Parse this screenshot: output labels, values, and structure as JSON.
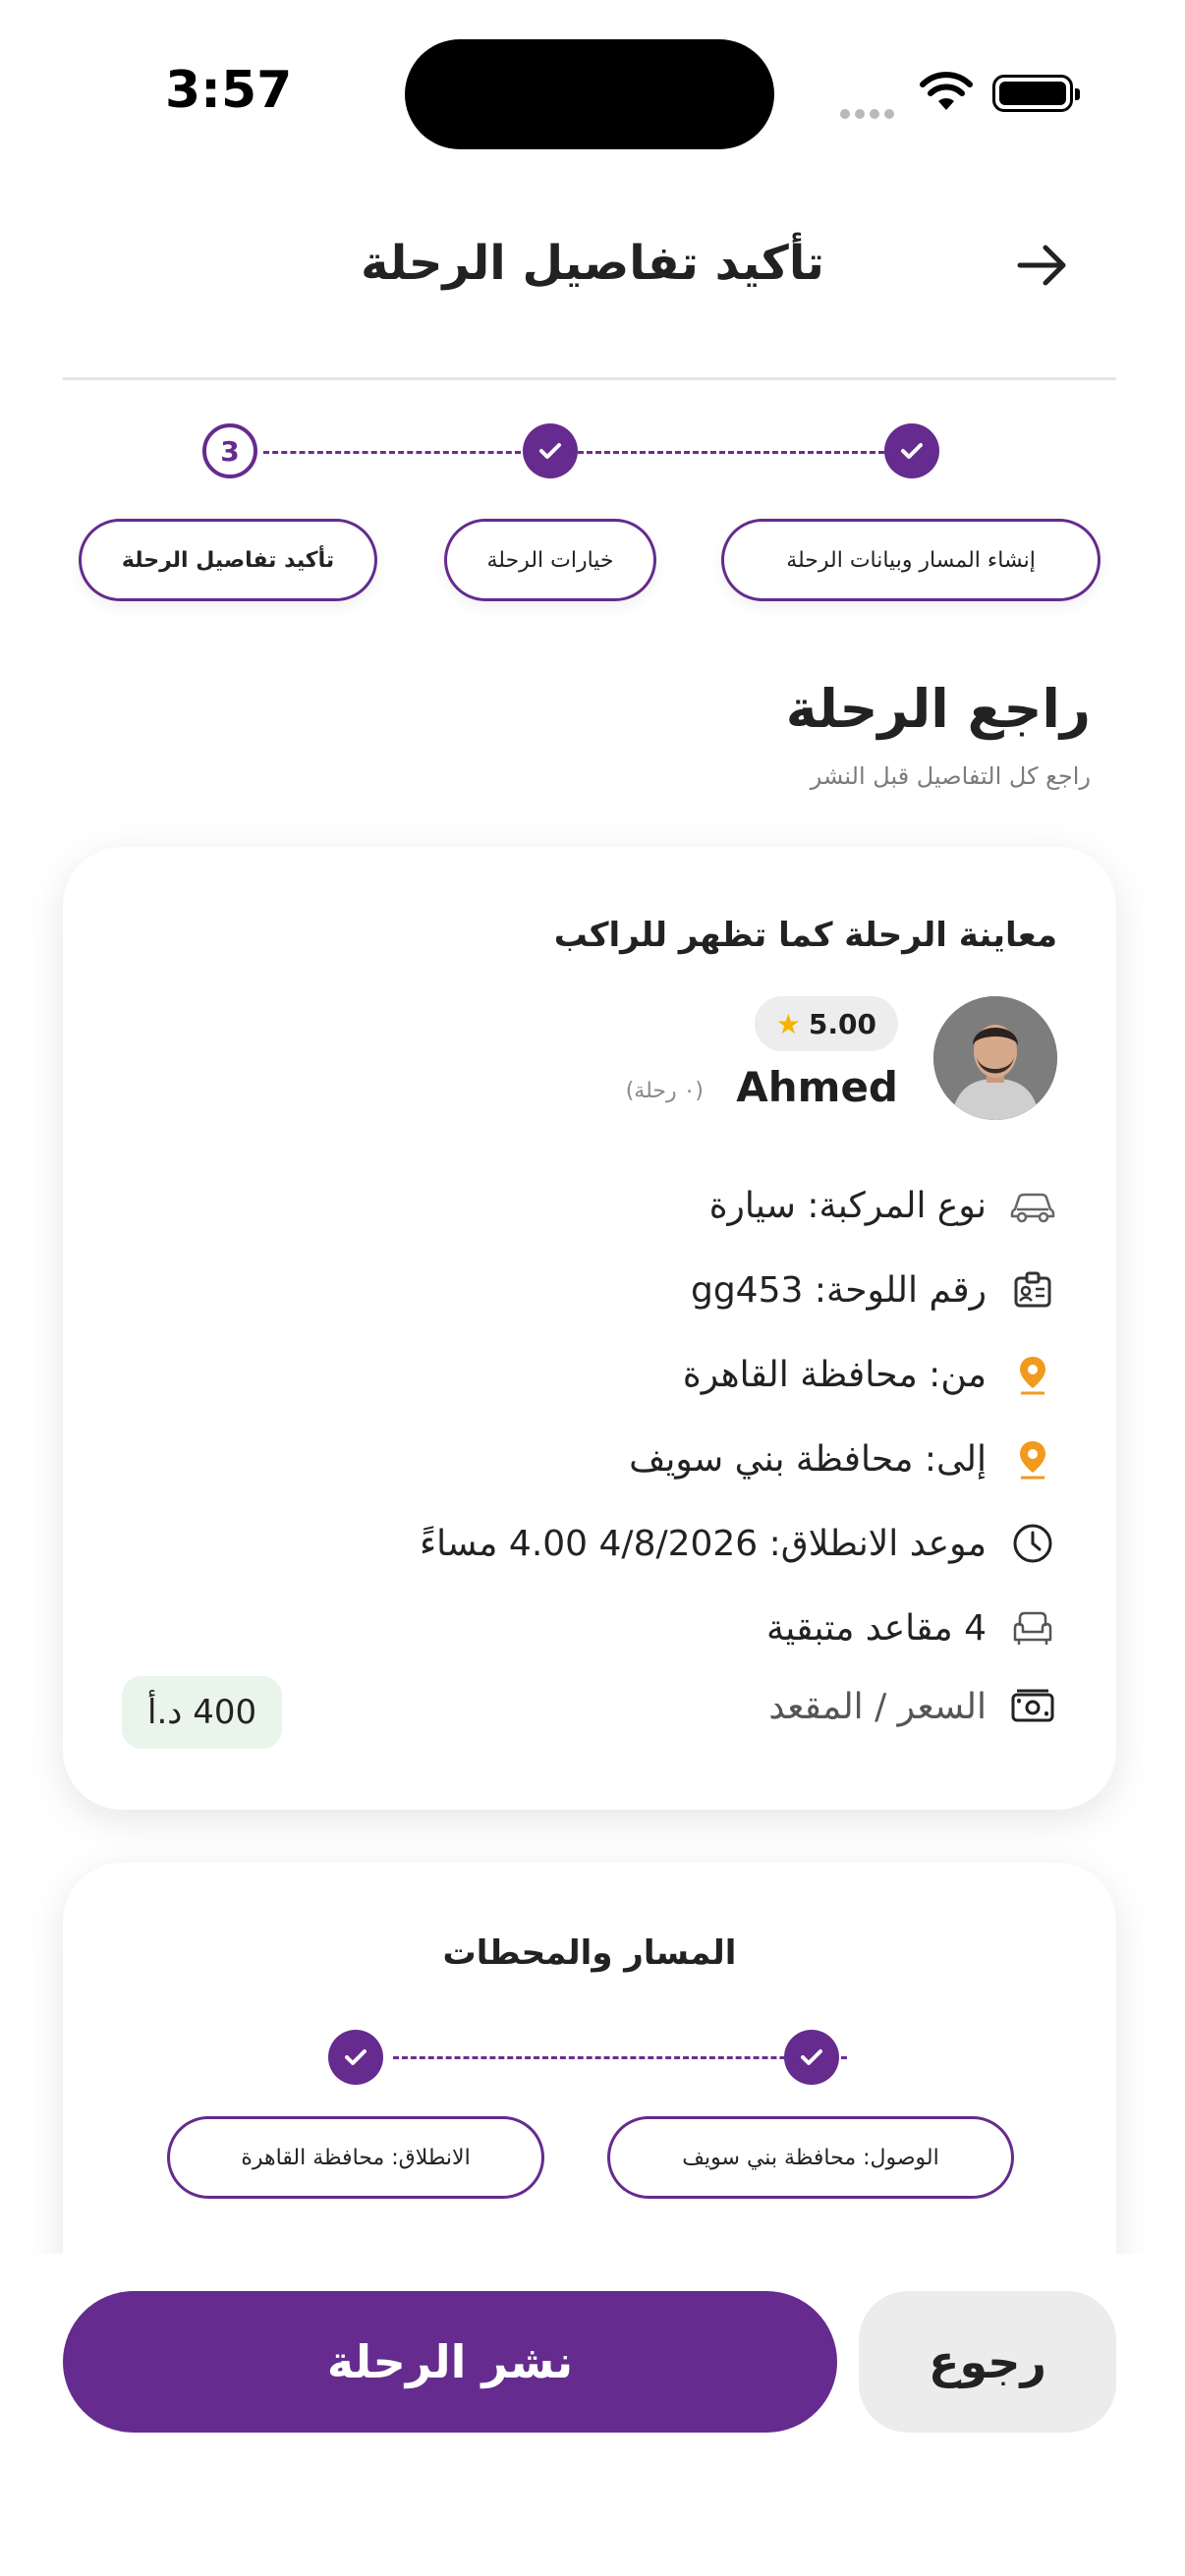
{
  "status_bar": {
    "time": "3:57"
  },
  "header": {
    "title": "تأكيد تفاصيل الرحلة"
  },
  "stepper": {
    "current_step_number": "3",
    "steps": [
      {
        "label": "إنشاء المسار وبيانات الرحلة",
        "state": "done"
      },
      {
        "label": "خيارات الرحلة",
        "state": "done"
      },
      {
        "label": "تأكيد تفاصيل الرحلة",
        "state": "current"
      }
    ]
  },
  "review": {
    "title": "راجع الرحلة",
    "subtitle": "راجع كل التفاصيل قبل النشر"
  },
  "preview_card": {
    "title": "معاينة الرحلة كما تظهر للراكب",
    "driver": {
      "name": "Ahmed",
      "rating": "5.00",
      "trips": "(٠ رحلة)"
    },
    "rows": [
      {
        "icon": "car-icon",
        "text": "نوع المركبة: سيارة"
      },
      {
        "icon": "id-card-icon",
        "text": "رقم اللوحة: gg453"
      },
      {
        "icon": "location-pin-icon",
        "text": "من: محافظة القاهرة"
      },
      {
        "icon": "location-pin-icon",
        "text": "إلى: محافظة بني سويف"
      },
      {
        "icon": "clock-icon",
        "text": "موعد الانطلاق: 4/8/2026 4.00 مساءً"
      },
      {
        "icon": "seat-icon",
        "text": "4 مقاعد متبقية"
      }
    ],
    "price_label": "السعر / المقعد",
    "price_value": "400 د.أ"
  },
  "route_card": {
    "title": "المسار والمحطات",
    "arrival": "الوصول: محافظة بني سويف",
    "departure": "الانطلاق: محافظة القاهرة"
  },
  "actions": {
    "publish": "نشر الرحلة",
    "back": "رجوع"
  },
  "colors": {
    "primary": "#652b8e",
    "pin": "#f29a1f",
    "price_bg": "#e9f4ea"
  }
}
